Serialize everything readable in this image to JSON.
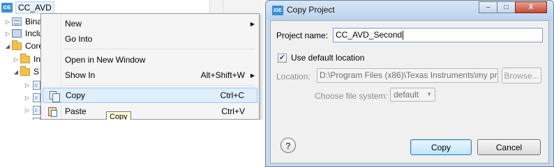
{
  "explorer": {
    "project_name": "CC_AVD",
    "project_badge": "IDE",
    "items": [
      {
        "label": "Bina",
        "icon": "binaries-icon"
      },
      {
        "label": "Inclu",
        "icon": "includes-icon"
      },
      {
        "label": "Core",
        "icon": "folder-icon"
      },
      {
        "label": "In",
        "icon": "folder-icon"
      },
      {
        "label": "S",
        "icon": "folder-icon"
      },
      {
        "label": "c",
        "icon": "c-file-icon"
      },
      {
        "label": "c",
        "icon": "c-file-icon"
      },
      {
        "label": "c",
        "icon": "c-file-icon"
      },
      {
        "label": "c",
        "icon": "c-file-icon"
      }
    ]
  },
  "context_menu": {
    "items": [
      {
        "label": "New",
        "shortcut": "",
        "submenu": true
      },
      {
        "label": "Go Into",
        "shortcut": "",
        "submenu": false
      },
      {
        "label": "Open in New Window",
        "shortcut": "",
        "submenu": false
      },
      {
        "label": "Show In",
        "shortcut": "Alt+Shift+W",
        "submenu": true
      },
      {
        "label": "Copy",
        "shortcut": "Ctrl+C",
        "submenu": false,
        "selected": true,
        "icon": "copy-icon"
      },
      {
        "label": "Paste",
        "shortcut": "Ctrl+V",
        "submenu": false,
        "icon": "paste-icon"
      }
    ],
    "tooltip": "Copy"
  },
  "dialog": {
    "title": "Copy Project",
    "title_badge": "IDE",
    "project_name_label": "Project name:",
    "project_name_value": "CC_AVD_Second",
    "use_default_label": "Use default location",
    "use_default_checked": true,
    "location_label": "Location:",
    "location_value": "D:\\Program Files (x86)\\Texas Instruments\\my pr",
    "browse_label": "Browse...",
    "file_system_label": "Choose file system:",
    "file_system_value": "default",
    "copy_label": "Copy",
    "cancel_label": "Cancel",
    "window_controls": {
      "minimize": "–",
      "maximize": "□",
      "close": "X"
    }
  },
  "colors": {
    "menu_highlight": "#dfeefb",
    "dialog_frame": "#c7d9ee",
    "ide_badge": "#3a8fd6"
  }
}
